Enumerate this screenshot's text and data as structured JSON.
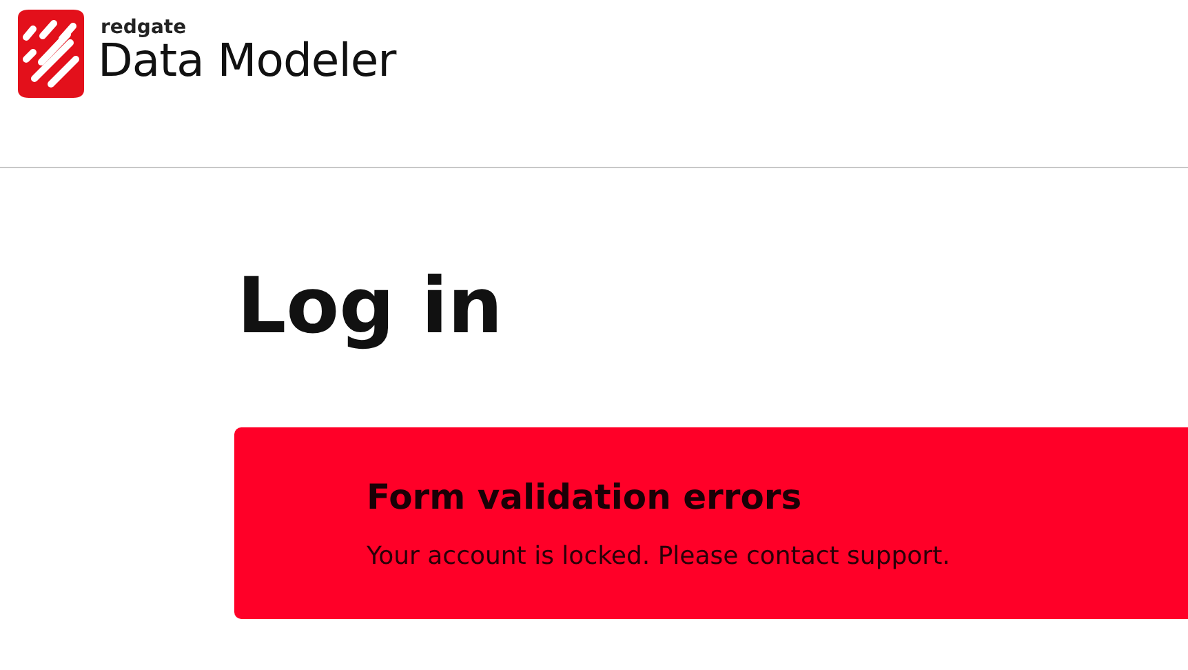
{
  "header": {
    "brand_small": "redgate",
    "brand_name": "Data Modeler"
  },
  "page": {
    "title": "Log in"
  },
  "alert": {
    "kind": "error",
    "title": "Form validation errors",
    "message": "Your account is locked. Please contact support."
  }
}
